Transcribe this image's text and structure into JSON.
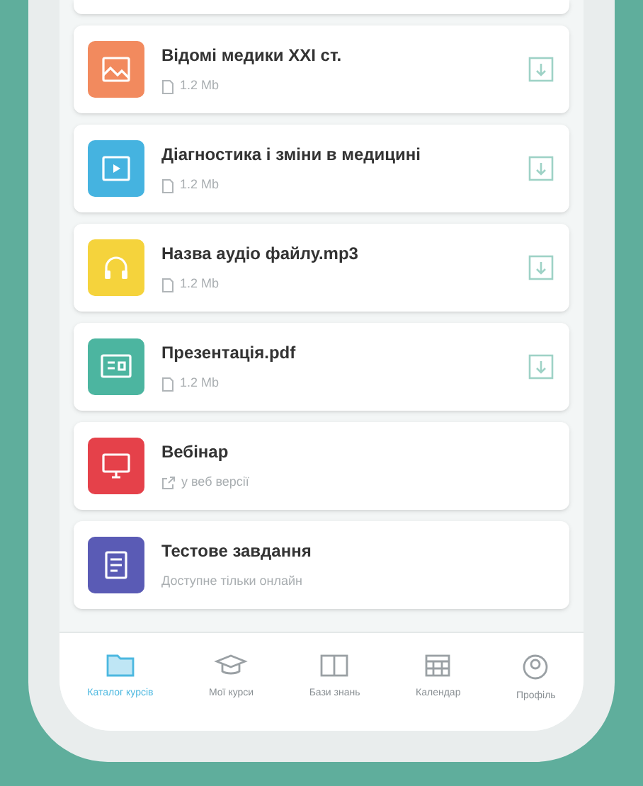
{
  "materials": [
    {
      "kind": "image",
      "color": "#f28a5e",
      "title": "Відомі медики XXI ст.",
      "meta": {
        "kind": "file",
        "text": "1.2 Mb"
      },
      "download": true
    },
    {
      "kind": "video",
      "color": "#45b3e0",
      "title": "Діагностика і зміни в медицині",
      "meta": {
        "kind": "file",
        "text": "1.2 Mb"
      },
      "download": true
    },
    {
      "kind": "audio",
      "color": "#f5d33c",
      "title": "Назва аудіо файлу.mp3",
      "meta": {
        "kind": "file",
        "text": "1.2 Mb"
      },
      "download": true
    },
    {
      "kind": "presentation",
      "color": "#4cb5a0",
      "title": "Презентація.pdf",
      "meta": {
        "kind": "file",
        "text": "1.2 Mb"
      },
      "download": true
    },
    {
      "kind": "webinar",
      "color": "#e5414a",
      "title": "Вебінар",
      "meta": {
        "kind": "link",
        "text": "у веб версії"
      },
      "download": false
    },
    {
      "kind": "test",
      "color": "#5a5bb5",
      "title": "Тестове завдання",
      "meta": {
        "kind": "plain",
        "text": "Доступне тільки онлайн"
      },
      "download": false
    }
  ],
  "nav": [
    {
      "kind": "catalog",
      "label": "Каталог курсів",
      "selected": true
    },
    {
      "kind": "courses",
      "label": "Мої курси",
      "selected": false
    },
    {
      "kind": "knowledge",
      "label": "Бази знань",
      "selected": false
    },
    {
      "kind": "calendar",
      "label": "Календар",
      "selected": false
    },
    {
      "kind": "profile",
      "label": "Профіль",
      "selected": false
    }
  ]
}
